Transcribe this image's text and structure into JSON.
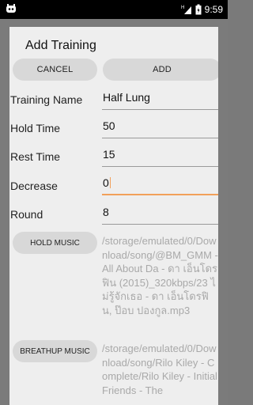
{
  "status_bar": {
    "time": "9:59",
    "icons": [
      "app-notification-icon",
      "signal-icon",
      "battery-icon"
    ]
  },
  "dialog": {
    "title": "Add Training",
    "cancel_label": "CANCEL",
    "add_label": "ADD",
    "fields": [
      {
        "label": "Training Name",
        "value": "Half Lung"
      },
      {
        "label": "Hold Time",
        "value": "50"
      },
      {
        "label": "Rest Time",
        "value": "15"
      },
      {
        "label": "Decrease",
        "value": "0"
      },
      {
        "label": "Round",
        "value": "8"
      }
    ],
    "hold_music": {
      "label": "HOLD MUSIC",
      "path": "/storage/emulated/0/Download/song/@BM_GMM - All About Da - ดา เอ็นโดรฟิน (2015)_320kbps/23 ไม่รู้จักเธอ - ดา เอ็นโดรฟิน, ป๊อบ ปองกูล.mp3"
    },
    "breathup_music": {
      "label": "BREATHUP MUSIC",
      "path": "/storage/emulated/0/Download/song/Rilo Kiley - Complete/Rilo Kiley - Initial Friends - The"
    }
  },
  "colors": {
    "accent": "#f2a05a",
    "dialog_bg": "#eeeeee",
    "button_bg": "#d8d8d8",
    "hint_text": "#a9a9a9"
  }
}
